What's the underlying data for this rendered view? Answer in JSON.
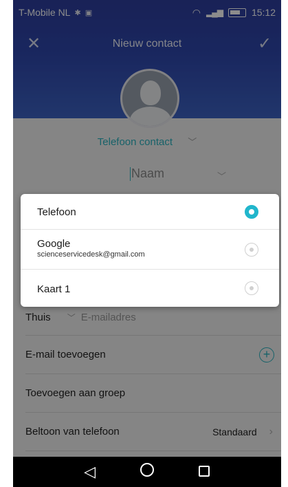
{
  "status_bar": {
    "carrier": "T-Mobile NL",
    "time": "15:12"
  },
  "header": {
    "title": "Nieuw contact"
  },
  "form": {
    "account_type": "Telefoon contact",
    "name_placeholder": "Naam",
    "email_type": "Thuis",
    "email_placeholder": "E-mailadres",
    "add_email": "E-mail toevoegen",
    "add_group": "Toevoegen aan groep",
    "ringtone_label": "Beltoon van telefoon",
    "ringtone_value": "Standaard"
  },
  "popup": {
    "options": [
      {
        "label": "Telefoon",
        "sublabel": "",
        "selected": true
      },
      {
        "label": "Google",
        "sublabel": "scienceservicedesk@gmail.com",
        "selected": false
      },
      {
        "label": "Kaart 1",
        "sublabel": "",
        "selected": false
      }
    ]
  },
  "colors": {
    "header": "#2f47ad",
    "accent": "#21b6cc"
  }
}
